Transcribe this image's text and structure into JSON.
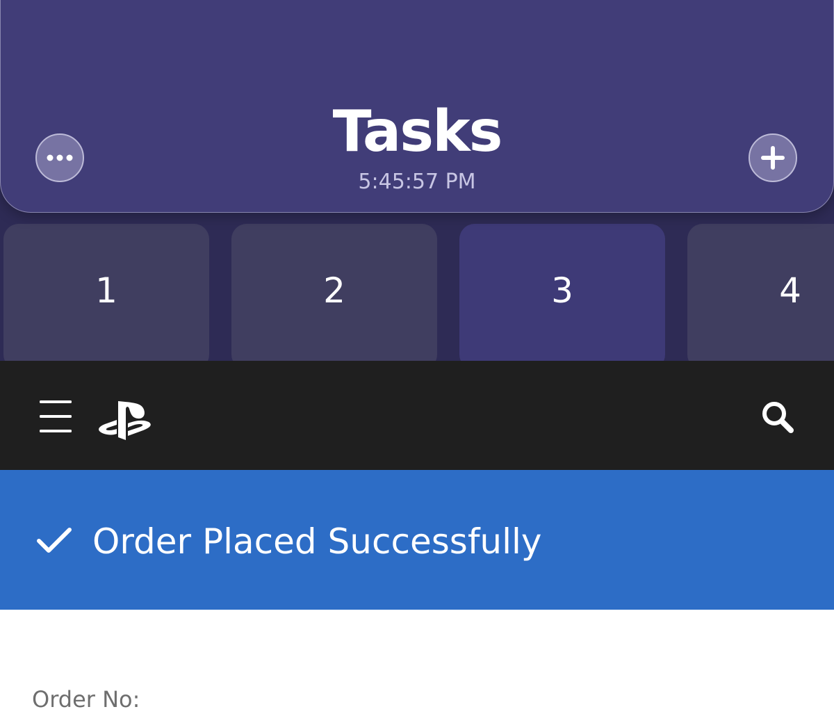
{
  "tasks_app": {
    "title": "Tasks",
    "time": "5:45:57 PM",
    "more_icon": "ellipsis-icon",
    "add_icon": "plus-icon",
    "desktops": [
      {
        "label": "1",
        "active": false
      },
      {
        "label": "2",
        "active": false
      },
      {
        "label": "3",
        "active": true
      },
      {
        "label": "4",
        "active": false
      }
    ]
  },
  "site": {
    "menu_icon": "hamburger-icon",
    "logo_icon": "playstation-logo",
    "search_icon": "search-icon",
    "banner": {
      "icon": "checkmark-icon",
      "text": "Order Placed Successfully"
    },
    "order": {
      "label": "Order No:"
    }
  },
  "colors": {
    "tasks_header": "#413d78",
    "tasks_background": "#2e2b55",
    "desktop_tile": "#403e60",
    "desktop_tile_active": "#3e3a77",
    "site_nav": "#1f1f1f",
    "banner": "#2d6dc6"
  }
}
